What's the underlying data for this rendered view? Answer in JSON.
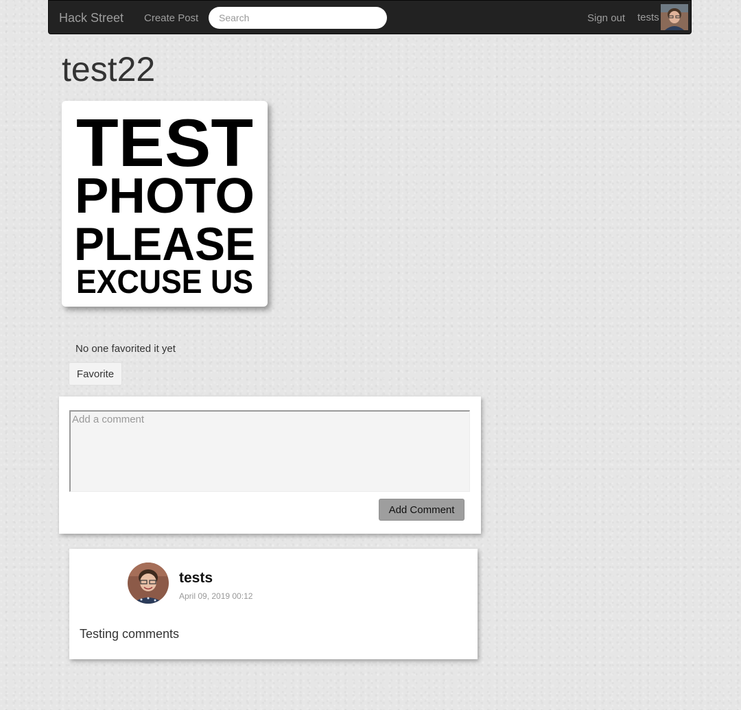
{
  "navbar": {
    "brand": "Hack Street",
    "create_post": "Create Post",
    "search_placeholder": "Search",
    "sign_out": "Sign out",
    "username": "tests"
  },
  "post": {
    "title": "test22",
    "image_text": [
      "TEST",
      "PHOTO",
      "PLEASE",
      "EXCUSE US"
    ],
    "favorites_text": "No one favorited it yet",
    "favorite_button": "Favorite"
  },
  "comment_form": {
    "placeholder": "Add a comment",
    "submit_label": "Add Comment"
  },
  "comments": [
    {
      "author": "tests",
      "date": "April 09, 2019 00:12",
      "body": "Testing comments"
    }
  ],
  "colors": {
    "navbar_bg": "#222222",
    "nav_text": "#9d9d9d",
    "add_comment_bg": "#9e9e9e"
  }
}
